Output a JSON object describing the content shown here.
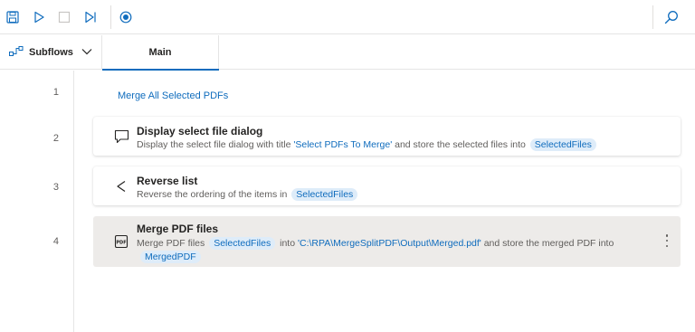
{
  "toolbar": {
    "buttons": [
      {
        "icon": "save-icon"
      },
      {
        "icon": "play-icon"
      },
      {
        "icon": "stop-icon"
      },
      {
        "icon": "next-step-icon"
      },
      {
        "icon": "record-icon"
      },
      {
        "icon": "search-icon"
      }
    ]
  },
  "tabs": {
    "subflows_label": "Subflows",
    "main_label": "Main"
  },
  "lines": [
    "1",
    "2",
    "3",
    "4"
  ],
  "actions": {
    "comment": "Merge All Selected PDFs",
    "display_dialog": {
      "title": "Display select file dialog",
      "desc_prefix": "Display the select file dialog with title ",
      "desc_literal": "'Select PDFs To Merge'",
      "desc_mid": " and store the selected files into ",
      "var": "SelectedFiles"
    },
    "reverse_list": {
      "title": "Reverse list",
      "desc_prefix": "Reverse the ordering of the items in ",
      "var": "SelectedFiles"
    },
    "merge_pdf": {
      "title": "Merge PDF files",
      "desc_prefix": "Merge PDF files ",
      "var_in": "SelectedFiles",
      "desc_into": " into ",
      "desc_literal": "'C:\\RPA\\MergeSplitPDF\\Output\\Merged.pdf'",
      "desc_store": " and store the merged PDF into",
      "var_out": "MergedPDF"
    }
  },
  "colors": {
    "accent": "#0f6cbd",
    "variable_bg": "#deecf9",
    "selected_bg": "#edebe9"
  }
}
